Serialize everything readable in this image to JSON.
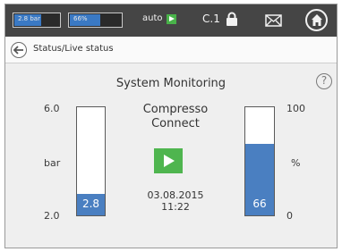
{
  "status_bar": {
    "pressure_mini": "2.8 bar",
    "percent_mini": "66%",
    "mode_label": "auto",
    "controller_label": "C.1"
  },
  "breadcrumb": {
    "text": "Status/Live status"
  },
  "main": {
    "title": "System Monitoring",
    "help_label": "?",
    "device_name_line1": "Compresso",
    "device_name_line2": "Connect",
    "date": "03.08.2015",
    "time": "11:22"
  },
  "pressure_gauge": {
    "max_label": "6.0",
    "min_label": "2.0",
    "unit": "bar",
    "value_label": "2.8",
    "fill_fraction": 0.2
  },
  "percent_gauge": {
    "max_label": "100",
    "min_label": "0",
    "unit": "%",
    "value_label": "66",
    "fill_fraction": 0.66
  },
  "colors": {
    "status_bar": "#454545",
    "gauge_fill": "#4a7fc1",
    "play_green": "#4fb54f"
  },
  "icons": [
    "play-icon",
    "lock-icon",
    "mail-icon",
    "home-icon",
    "back-arrow-icon",
    "help-icon"
  ]
}
